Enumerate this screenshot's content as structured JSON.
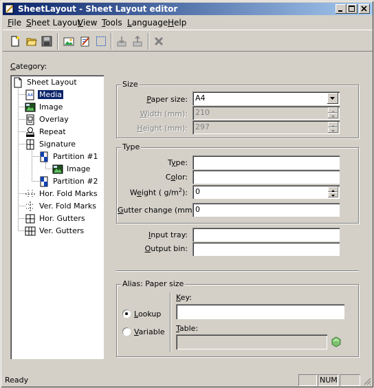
{
  "window": {
    "title": "SheetLayout - Sheet Layout editor"
  },
  "menu": [
    {
      "pre": "",
      "u": "F",
      "post": "ile"
    },
    {
      "pre": "",
      "u": "S",
      "post": "heet Layout"
    },
    {
      "pre": "",
      "u": "V",
      "post": "iew"
    },
    {
      "pre": "",
      "u": "T",
      "post": "ools"
    },
    {
      "pre": "",
      "u": "L",
      "post": "anguage"
    },
    {
      "pre": "",
      "u": "H",
      "post": "elp"
    }
  ],
  "toolbar": {
    "icons": [
      "new-icon",
      "open-icon",
      "save-icon",
      "image-icon",
      "edit-icon",
      "select-icon",
      "import-icon",
      "export-icon",
      "delete-icon"
    ]
  },
  "category": {
    "label_u": "C",
    "label_rest": "ategory:",
    "tree": [
      {
        "label": "Sheet Layout",
        "icon": "page-icon"
      },
      {
        "label": "Media",
        "icon": "media-icon",
        "selected": true
      },
      {
        "label": "Image",
        "icon": "image-icon"
      },
      {
        "label": "Overlay",
        "icon": "overlay-icon"
      },
      {
        "label": "Repeat",
        "icon": "repeat-icon"
      },
      {
        "label": "Signature",
        "icon": "signature-icon"
      },
      {
        "label": "Partition #1",
        "icon": "partition-icon"
      },
      {
        "label": "Image",
        "icon": "image-icon"
      },
      {
        "label": "Partition #2",
        "icon": "partition-icon"
      },
      {
        "label": "Hor. Fold Marks",
        "icon": "fold-marks-icon"
      },
      {
        "label": "Ver. Fold Marks",
        "icon": "fold-marks-icon"
      },
      {
        "label": "Hor. Gutters",
        "icon": "gutters-icon"
      },
      {
        "label": "Ver. Gutters",
        "icon": "gutters-icon"
      }
    ]
  },
  "size": {
    "title": "Size",
    "paper_size_label_u": "P",
    "paper_size_label_rest": "aper size:",
    "paper_size_value": "A4",
    "width_label_u": "W",
    "width_label_rest": "idth  (mm):",
    "width_value": "210",
    "height_label_u": "H",
    "height_label_rest": "eight  (mm):",
    "height_value": "297"
  },
  "type": {
    "title": "Type",
    "type_label_pre": "T",
    "type_label_u": "y",
    "type_label_rest": "pe:",
    "type_value": "",
    "color_label_pre": "C",
    "color_label_u": "o",
    "color_label_rest": "lor:",
    "color_value": "",
    "weight_label_pre": "W",
    "weight_label_u": "e",
    "weight_label_rest": "ight ( g/m",
    "weight_sup": "2",
    "weight_close": "):",
    "weight_value": "0",
    "gutter_label_u": "G",
    "gutter_label_rest": "utter change (mm):",
    "gutter_value": "0"
  },
  "trays": {
    "input_label_u": "I",
    "input_label_rest": "nput tray:",
    "input_value": "",
    "output_label_u": "O",
    "output_label_rest": "utput bin:",
    "output_value": ""
  },
  "alias": {
    "title": "Alias: Paper size",
    "lookup_u": "L",
    "lookup_rest": "ookup",
    "variable_u": "V",
    "variable_rest": "ariable",
    "key_label_u": "K",
    "key_label_rest": "ey:",
    "key_value": "",
    "table_label_u": "T",
    "table_label_rest": "able:",
    "table_value": ""
  },
  "status": {
    "text": "Ready",
    "num": "NUM"
  },
  "colors": {
    "title_start": "#0a246a",
    "title_end": "#a6caf0",
    "selection": "#0a246a",
    "face": "#d4d0c8"
  }
}
